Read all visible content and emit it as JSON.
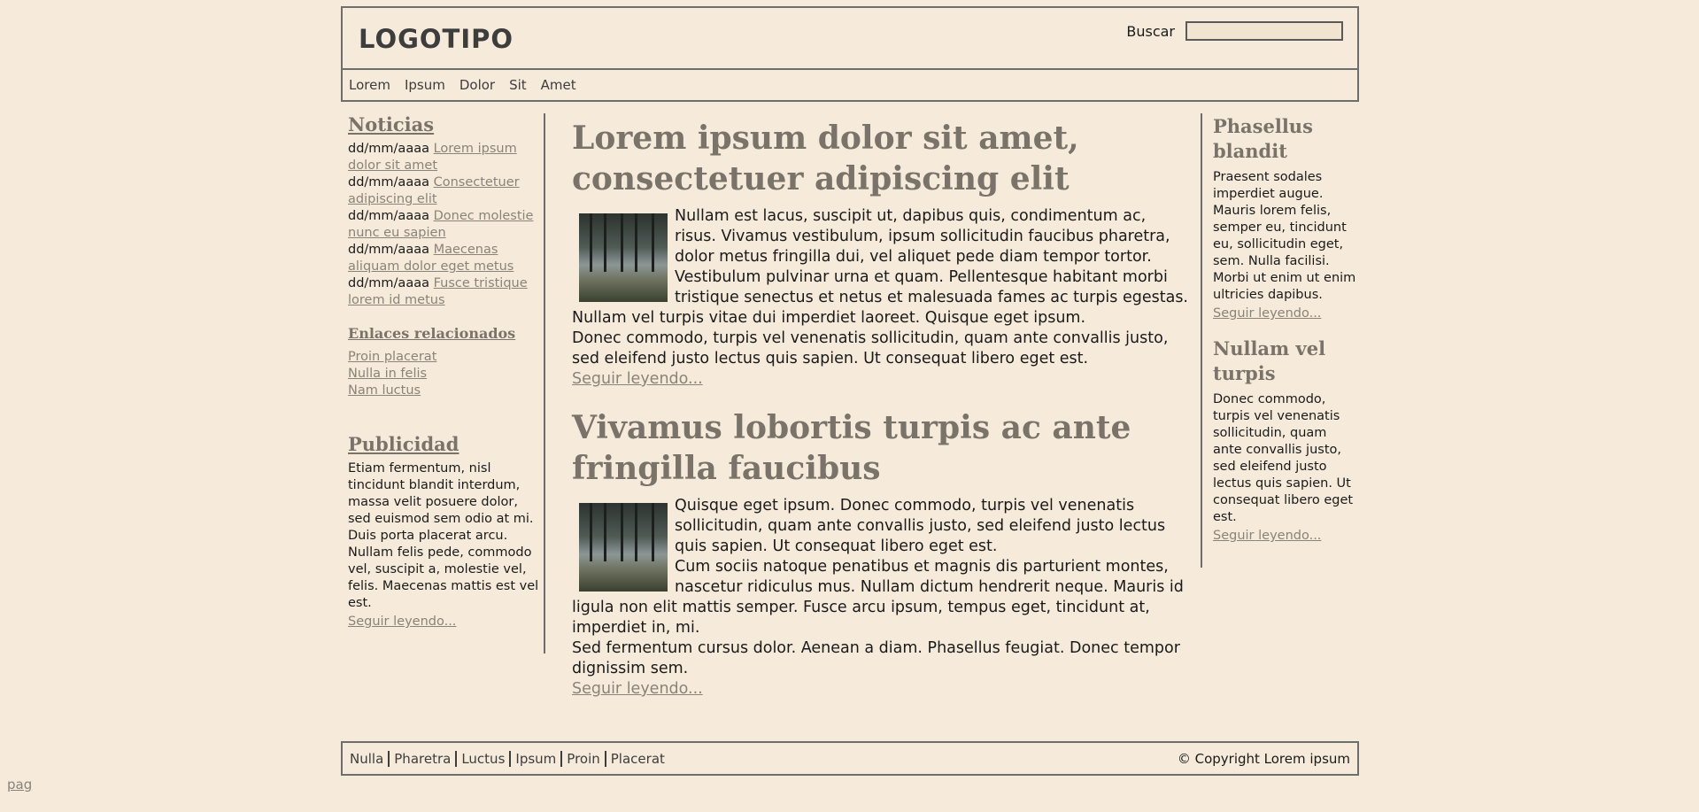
{
  "header": {
    "logo": "LOGOTIPO",
    "search_label": "Buscar",
    "search_value": ""
  },
  "nav": [
    "Lorem",
    "Ipsum",
    "Dolor",
    "Sit",
    "Amet"
  ],
  "sidebar_left": {
    "news_title": "Noticias",
    "news": [
      {
        "date": "dd/mm/aaaa",
        "link": "Lorem ipsum dolor sit amet"
      },
      {
        "date": "dd/mm/aaaa",
        "link": "Consectetuer adipiscing elit"
      },
      {
        "date": "dd/mm/aaaa",
        "link": "Donec molestie nunc eu sapien"
      },
      {
        "date": "dd/mm/aaaa",
        "link": "Maecenas aliquam dolor eget metus"
      },
      {
        "date": "dd/mm/aaaa",
        "link": "Fusce tristique lorem id metus"
      }
    ],
    "related_title": "Enlaces relacionados",
    "related": [
      "Proin placerat",
      "Nulla in felis",
      "Nam luctus"
    ],
    "ads_title": "Publicidad",
    "ads_text": "Etiam fermentum, nisl tincidunt blandit interdum, massa velit posuere dolor, sed euismod sem odio at mi. Duis porta placerat arcu. Nullam felis pede, commodo vel, suscipit a, molestie vel, felis. Maecenas mattis est vel est.",
    "ads_more": "Seguir leyendo..."
  },
  "articles": [
    {
      "title": "Lorem ipsum dolor sit amet, consectetuer adipiscing elit",
      "p1": "Nullam est lacus, suscipit ut, dapibus quis, condimentum ac, risus. Vivamus vestibulum, ipsum sollicitudin faucibus pharetra, dolor metus fringilla dui, vel aliquet pede diam tempor tortor. Vestibulum pulvinar urna et quam. Pellentesque habitant morbi tristique senectus et netus et malesuada fames ac turpis egestas. Nullam vel turpis vitae dui imperdiet laoreet. Quisque eget ipsum.",
      "p2": "Donec commodo, turpis vel venenatis sollicitudin, quam ante convallis justo, sed eleifend justo lectus quis sapien. Ut consequat libero eget est.",
      "p3": "",
      "more": "Seguir leyendo..."
    },
    {
      "title": "Vivamus lobortis turpis ac ante fringilla faucibus",
      "p1": "Quisque eget ipsum. Donec commodo, turpis vel venenatis sollicitudin, quam ante convallis justo, sed eleifend justo lectus quis sapien. Ut consequat libero eget est.",
      "p2": "Cum sociis natoque penatibus et magnis dis parturient montes, nascetur ridiculus mus. Nullam dictum hendrerit neque. Mauris id ligula non elit mattis semper. Fusce arcu ipsum, tempus eget, tincidunt at, imperdiet in, mi.",
      "p3": "Sed fermentum cursus dolor. Aenean a diam. Phasellus feugiat. Donec tempor dignissim sem.",
      "more": "Seguir leyendo..."
    }
  ],
  "sidebar_right": [
    {
      "title": "Phasellus blandit",
      "text": "Praesent sodales imperdiet augue. Mauris lorem felis, semper eu, tincidunt eu, sollicitudin eget, sem. Nulla facilisi. Morbi ut enim ut enim ultricies dapibus.",
      "more": "Seguir leyendo..."
    },
    {
      "title": "Nullam vel turpis",
      "text": "Donec commodo, turpis vel venenatis sollicitudin, quam ante convallis justo, sed eleifend justo lectus quis sapien. Ut consequat libero eget est.",
      "more": "Seguir leyendo..."
    }
  ],
  "footer": {
    "links": [
      "Nulla",
      "Pharetra",
      "Luctus",
      "Ipsum",
      "Proin",
      "Placerat"
    ],
    "copyright": "© Copyright Lorem ipsum"
  },
  "pag_link": "pag"
}
